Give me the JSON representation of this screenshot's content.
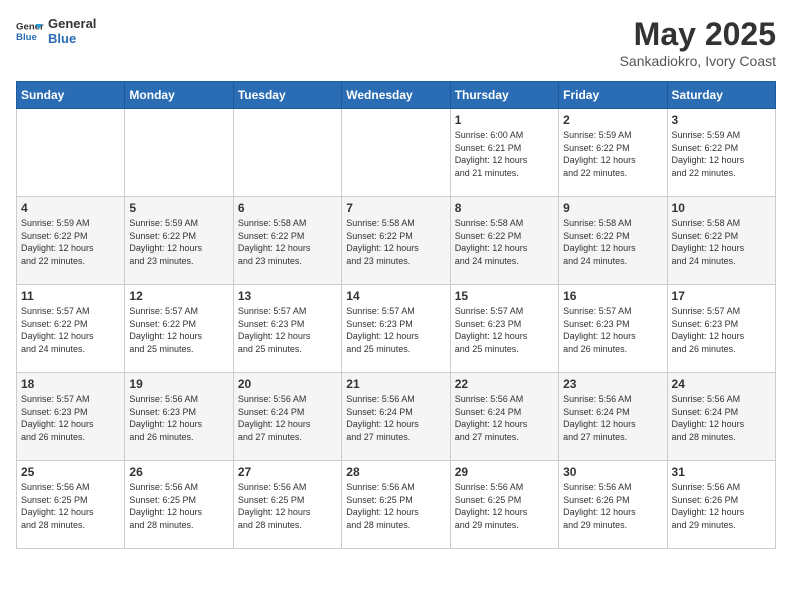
{
  "header": {
    "logo_line1": "General",
    "logo_line2": "Blue",
    "month_year": "May 2025",
    "location": "Sankadiokro, Ivory Coast"
  },
  "days_of_week": [
    "Sunday",
    "Monday",
    "Tuesday",
    "Wednesday",
    "Thursday",
    "Friday",
    "Saturday"
  ],
  "weeks": [
    [
      {
        "day": "",
        "content": ""
      },
      {
        "day": "",
        "content": ""
      },
      {
        "day": "",
        "content": ""
      },
      {
        "day": "",
        "content": ""
      },
      {
        "day": "1",
        "content": "Sunrise: 6:00 AM\nSunset: 6:21 PM\nDaylight: 12 hours\nand 21 minutes."
      },
      {
        "day": "2",
        "content": "Sunrise: 5:59 AM\nSunset: 6:22 PM\nDaylight: 12 hours\nand 22 minutes."
      },
      {
        "day": "3",
        "content": "Sunrise: 5:59 AM\nSunset: 6:22 PM\nDaylight: 12 hours\nand 22 minutes."
      }
    ],
    [
      {
        "day": "4",
        "content": "Sunrise: 5:59 AM\nSunset: 6:22 PM\nDaylight: 12 hours\nand 22 minutes."
      },
      {
        "day": "5",
        "content": "Sunrise: 5:59 AM\nSunset: 6:22 PM\nDaylight: 12 hours\nand 23 minutes."
      },
      {
        "day": "6",
        "content": "Sunrise: 5:58 AM\nSunset: 6:22 PM\nDaylight: 12 hours\nand 23 minutes."
      },
      {
        "day": "7",
        "content": "Sunrise: 5:58 AM\nSunset: 6:22 PM\nDaylight: 12 hours\nand 23 minutes."
      },
      {
        "day": "8",
        "content": "Sunrise: 5:58 AM\nSunset: 6:22 PM\nDaylight: 12 hours\nand 24 minutes."
      },
      {
        "day": "9",
        "content": "Sunrise: 5:58 AM\nSunset: 6:22 PM\nDaylight: 12 hours\nand 24 minutes."
      },
      {
        "day": "10",
        "content": "Sunrise: 5:58 AM\nSunset: 6:22 PM\nDaylight: 12 hours\nand 24 minutes."
      }
    ],
    [
      {
        "day": "11",
        "content": "Sunrise: 5:57 AM\nSunset: 6:22 PM\nDaylight: 12 hours\nand 24 minutes."
      },
      {
        "day": "12",
        "content": "Sunrise: 5:57 AM\nSunset: 6:22 PM\nDaylight: 12 hours\nand 25 minutes."
      },
      {
        "day": "13",
        "content": "Sunrise: 5:57 AM\nSunset: 6:23 PM\nDaylight: 12 hours\nand 25 minutes."
      },
      {
        "day": "14",
        "content": "Sunrise: 5:57 AM\nSunset: 6:23 PM\nDaylight: 12 hours\nand 25 minutes."
      },
      {
        "day": "15",
        "content": "Sunrise: 5:57 AM\nSunset: 6:23 PM\nDaylight: 12 hours\nand 25 minutes."
      },
      {
        "day": "16",
        "content": "Sunrise: 5:57 AM\nSunset: 6:23 PM\nDaylight: 12 hours\nand 26 minutes."
      },
      {
        "day": "17",
        "content": "Sunrise: 5:57 AM\nSunset: 6:23 PM\nDaylight: 12 hours\nand 26 minutes."
      }
    ],
    [
      {
        "day": "18",
        "content": "Sunrise: 5:57 AM\nSunset: 6:23 PM\nDaylight: 12 hours\nand 26 minutes."
      },
      {
        "day": "19",
        "content": "Sunrise: 5:56 AM\nSunset: 6:23 PM\nDaylight: 12 hours\nand 26 minutes."
      },
      {
        "day": "20",
        "content": "Sunrise: 5:56 AM\nSunset: 6:24 PM\nDaylight: 12 hours\nand 27 minutes."
      },
      {
        "day": "21",
        "content": "Sunrise: 5:56 AM\nSunset: 6:24 PM\nDaylight: 12 hours\nand 27 minutes."
      },
      {
        "day": "22",
        "content": "Sunrise: 5:56 AM\nSunset: 6:24 PM\nDaylight: 12 hours\nand 27 minutes."
      },
      {
        "day": "23",
        "content": "Sunrise: 5:56 AM\nSunset: 6:24 PM\nDaylight: 12 hours\nand 27 minutes."
      },
      {
        "day": "24",
        "content": "Sunrise: 5:56 AM\nSunset: 6:24 PM\nDaylight: 12 hours\nand 28 minutes."
      }
    ],
    [
      {
        "day": "25",
        "content": "Sunrise: 5:56 AM\nSunset: 6:25 PM\nDaylight: 12 hours\nand 28 minutes."
      },
      {
        "day": "26",
        "content": "Sunrise: 5:56 AM\nSunset: 6:25 PM\nDaylight: 12 hours\nand 28 minutes."
      },
      {
        "day": "27",
        "content": "Sunrise: 5:56 AM\nSunset: 6:25 PM\nDaylight: 12 hours\nand 28 minutes."
      },
      {
        "day": "28",
        "content": "Sunrise: 5:56 AM\nSunset: 6:25 PM\nDaylight: 12 hours\nand 28 minutes."
      },
      {
        "day": "29",
        "content": "Sunrise: 5:56 AM\nSunset: 6:25 PM\nDaylight: 12 hours\nand 29 minutes."
      },
      {
        "day": "30",
        "content": "Sunrise: 5:56 AM\nSunset: 6:26 PM\nDaylight: 12 hours\nand 29 minutes."
      },
      {
        "day": "31",
        "content": "Sunrise: 5:56 AM\nSunset: 6:26 PM\nDaylight: 12 hours\nand 29 minutes."
      }
    ]
  ]
}
